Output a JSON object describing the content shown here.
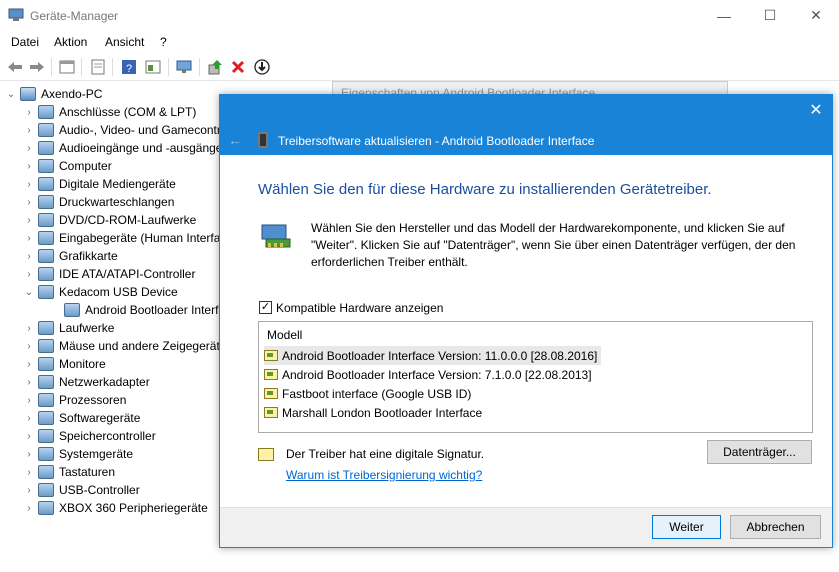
{
  "window": {
    "title": "Geräte-Manager",
    "minimize": "—",
    "maximize": "☐",
    "close": "✕"
  },
  "menu": [
    "Datei",
    "Aktion",
    "Ansicht",
    "?"
  ],
  "toolbar": {
    "icons": [
      "back-arrow-icon",
      "forward-arrow-icon",
      "properties-icon",
      "show-hidden-icon",
      "help-icon",
      "details-icon",
      "monitor-icon",
      "update-driver-icon",
      "uninstall-icon",
      "download-icon"
    ]
  },
  "tree": {
    "root": "Axendo-PC",
    "items": [
      {
        "label": "Anschlüsse (COM & LPT)",
        "expanded": false,
        "icon": "port-icon"
      },
      {
        "label": "Audio-, Video- und Gamecontroller",
        "expanded": false,
        "icon": "audio-icon"
      },
      {
        "label": "Audioeingänge und -ausgänge",
        "expanded": false,
        "icon": "speaker-icon"
      },
      {
        "label": "Computer",
        "expanded": false,
        "icon": "computer-icon"
      },
      {
        "label": "Digitale Mediengeräte",
        "expanded": false,
        "icon": "media-icon"
      },
      {
        "label": "Druckwarteschlangen",
        "expanded": false,
        "icon": "printer-icon"
      },
      {
        "label": "DVD/CD-ROM-Laufwerke",
        "expanded": false,
        "icon": "dvd-icon"
      },
      {
        "label": "Eingabegeräte (Human Interface Devices)",
        "expanded": false,
        "icon": "hid-icon"
      },
      {
        "label": "Grafikkarte",
        "expanded": false,
        "icon": "graphics-icon"
      },
      {
        "label": "IDE ATA/ATAPI-Controller",
        "expanded": false,
        "icon": "ide-icon"
      },
      {
        "label": "Kedacom USB Device",
        "expanded": true,
        "icon": "usb-device-icon"
      },
      {
        "label": "Android Bootloader Interface",
        "child": true,
        "icon": "android-device-icon"
      },
      {
        "label": "Laufwerke",
        "expanded": false,
        "icon": "drive-icon"
      },
      {
        "label": "Mäuse und andere Zeigegeräte",
        "expanded": false,
        "icon": "mouse-icon"
      },
      {
        "label": "Monitore",
        "expanded": false,
        "icon": "monitor-icon"
      },
      {
        "label": "Netzwerkadapter",
        "expanded": false,
        "icon": "network-icon"
      },
      {
        "label": "Prozessoren",
        "expanded": false,
        "icon": "cpu-icon"
      },
      {
        "label": "Softwaregeräte",
        "expanded": false,
        "icon": "software-icon"
      },
      {
        "label": "Speichercontroller",
        "expanded": false,
        "icon": "storage-icon"
      },
      {
        "label": "Systemgeräte",
        "expanded": false,
        "icon": "system-icon"
      },
      {
        "label": "Tastaturen",
        "expanded": false,
        "icon": "keyboard-icon"
      },
      {
        "label": "USB-Controller",
        "expanded": false,
        "icon": "usb-icon"
      },
      {
        "label": "XBOX 360 Peripheriegeräte",
        "expanded": false,
        "icon": "gamepad-icon"
      }
    ]
  },
  "background_dialog": {
    "title": "Eigenschaften von Android Bootloader Interface"
  },
  "wizard": {
    "close": "✕",
    "back": "←",
    "title": "Treibersoftware aktualisieren - Android Bootloader Interface",
    "heading": "Wählen Sie den für diese Hardware zu installierenden Gerätetreiber.",
    "description": "Wählen Sie den Hersteller und das Modell der Hardwarekomponente, und klicken Sie auf \"Weiter\". Klicken Sie auf \"Datenträger\", wenn Sie über einen Datenträger verfügen, der den erforderlichen Treiber enthält.",
    "compatible_label": "Kompatible Hardware anzeigen",
    "compatible_checked": "✓",
    "list_header": "Modell",
    "models": [
      "Android Bootloader Interface Version: 11.0.0.0 [28.08.2016]",
      "Android Bootloader Interface Version: 7.1.0.0 [22.08.2013]",
      "Fastboot interface (Google USB ID)",
      "Marshall London Bootloader Interface"
    ],
    "selected_index": 0,
    "signature_text": "Der Treiber hat eine digitale Signatur.",
    "signature_link": "Warum ist Treibersignierung wichtig?",
    "disk_button": "Datenträger...",
    "next_button": "Weiter",
    "cancel_button": "Abbrechen"
  },
  "colors": {
    "accent": "#1883d7",
    "heading": "#1a4f9e",
    "link": "#0066cc"
  }
}
